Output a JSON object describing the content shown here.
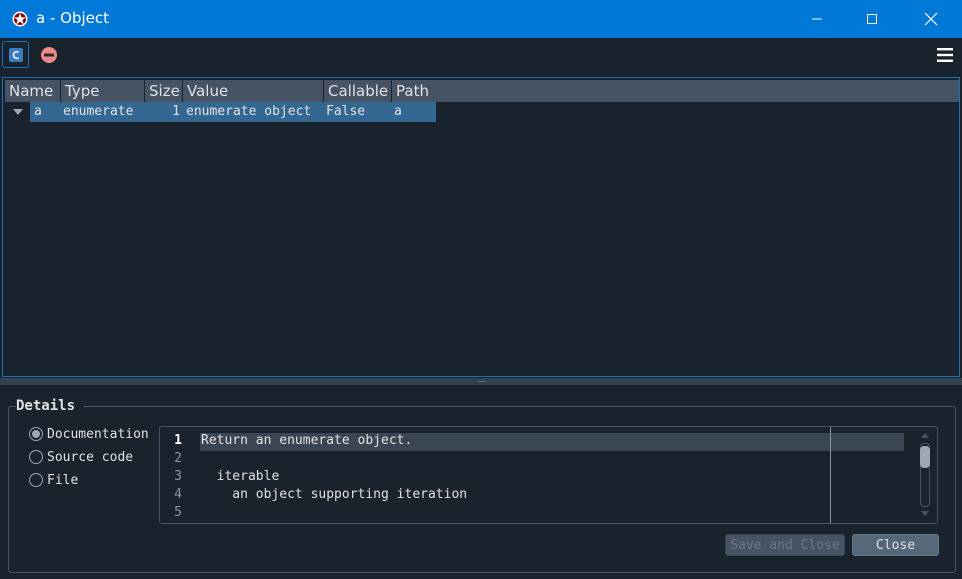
{
  "window": {
    "title": "a - Object",
    "controls": {
      "minimize_icon": "minimize-icon",
      "maximize_icon": "maximize-icon",
      "close_icon": "close-icon"
    }
  },
  "toolbar": {
    "icons": [
      "class-view-icon",
      "remove-icon",
      "hamburger-menu-icon"
    ]
  },
  "tree": {
    "columns": [
      "Name",
      "Type",
      "Size",
      "Value",
      "Callable",
      "Path"
    ],
    "rows": [
      {
        "name": "a",
        "type": "enumerate",
        "size": "1",
        "value": "enumerate object",
        "callable": "False",
        "path": "a",
        "expanded": true,
        "selected": true
      }
    ]
  },
  "details": {
    "title": "Details",
    "options": [
      {
        "label": "Documentation",
        "checked": true
      },
      {
        "label": "Source code",
        "checked": false
      },
      {
        "label": "File",
        "checked": false
      }
    ],
    "editor": {
      "lines": [
        {
          "number": "1",
          "text": "Return an enumerate object."
        },
        {
          "number": "2",
          "text": ""
        },
        {
          "number": "3",
          "text": "  iterable"
        },
        {
          "number": "4",
          "text": "    an object supporting iteration"
        },
        {
          "number": "5",
          "text": ""
        }
      ],
      "current_line": 1
    }
  },
  "buttons": {
    "save_and_close": "Save and Close",
    "close": "Close"
  },
  "colors": {
    "titlebar": "#0078d7",
    "background": "#19232d",
    "accent_border": "#1a72bb",
    "selection": "#346792",
    "header": "#455364"
  }
}
